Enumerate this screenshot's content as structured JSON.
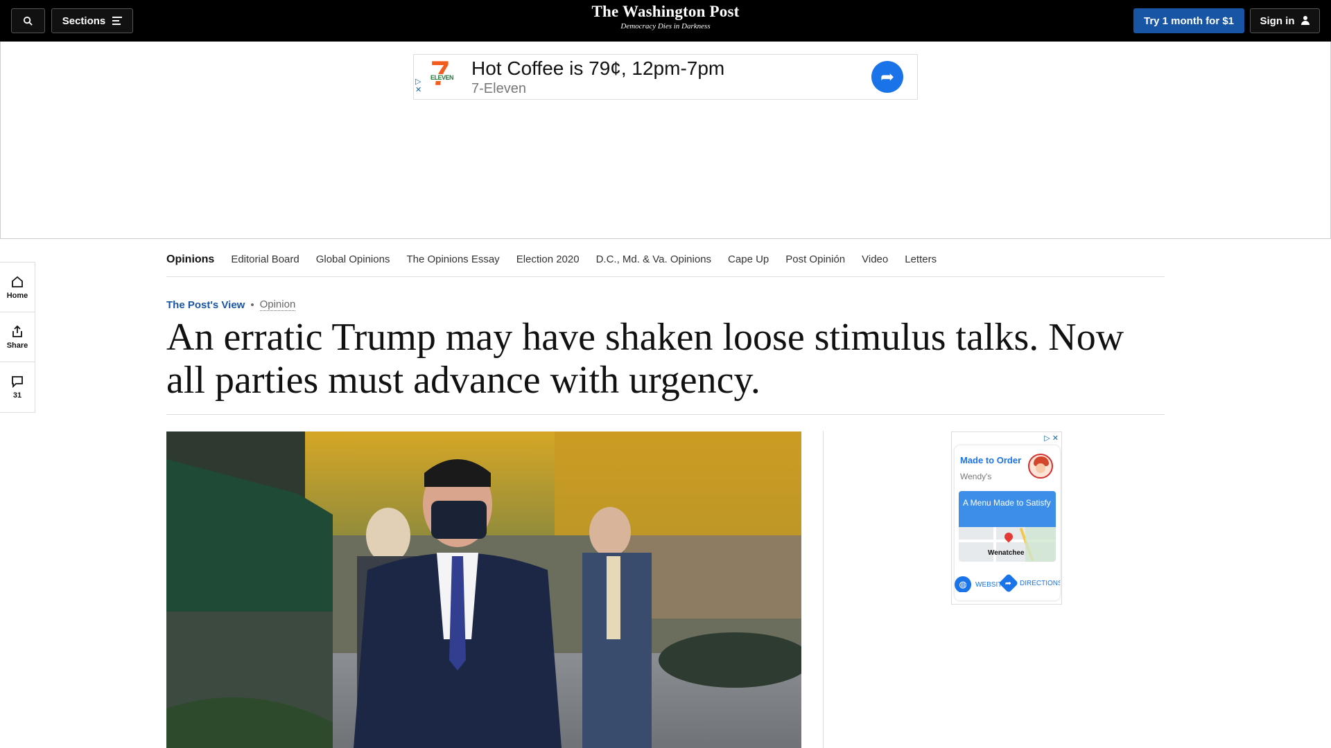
{
  "topbar": {
    "sections_label": "Sections",
    "logo_text": "The Washington Post",
    "tagline": "Democracy Dies in Darkness",
    "try_label": "Try 1 month for $1",
    "signin_label": "Sign in"
  },
  "top_ad": {
    "headline": "Hot Coffee is 79¢, 12pm-7pm",
    "advertiser": "7-Eleven",
    "logo_seven": "7",
    "logo_eleven": "ELEVEN"
  },
  "section_nav": {
    "active": "Opinions",
    "items": [
      "Editorial Board",
      "Global Opinions",
      "The Opinions Essay",
      "Election 2020",
      "D.C., Md. & Va. Opinions",
      "Cape Up",
      "Post Opinión",
      "Video",
      "Letters"
    ]
  },
  "left_rail": {
    "home_label": "Home",
    "share_label": "Share",
    "comments_count": "31"
  },
  "article": {
    "kicker": "The Post's View",
    "kicker_sep": "•",
    "category": "Opinion",
    "headline": "An erratic Trump may have shaken loose stimulus talks. Now all parties must advance with urgency."
  },
  "right_ad": {
    "title": "Made to Order",
    "advertiser": "Wendy's",
    "promo": "A Menu Made to Satisfy",
    "map_label": "Wenatchee",
    "website_label": "WEBSITE",
    "directions_label": "DIRECTIONS"
  }
}
